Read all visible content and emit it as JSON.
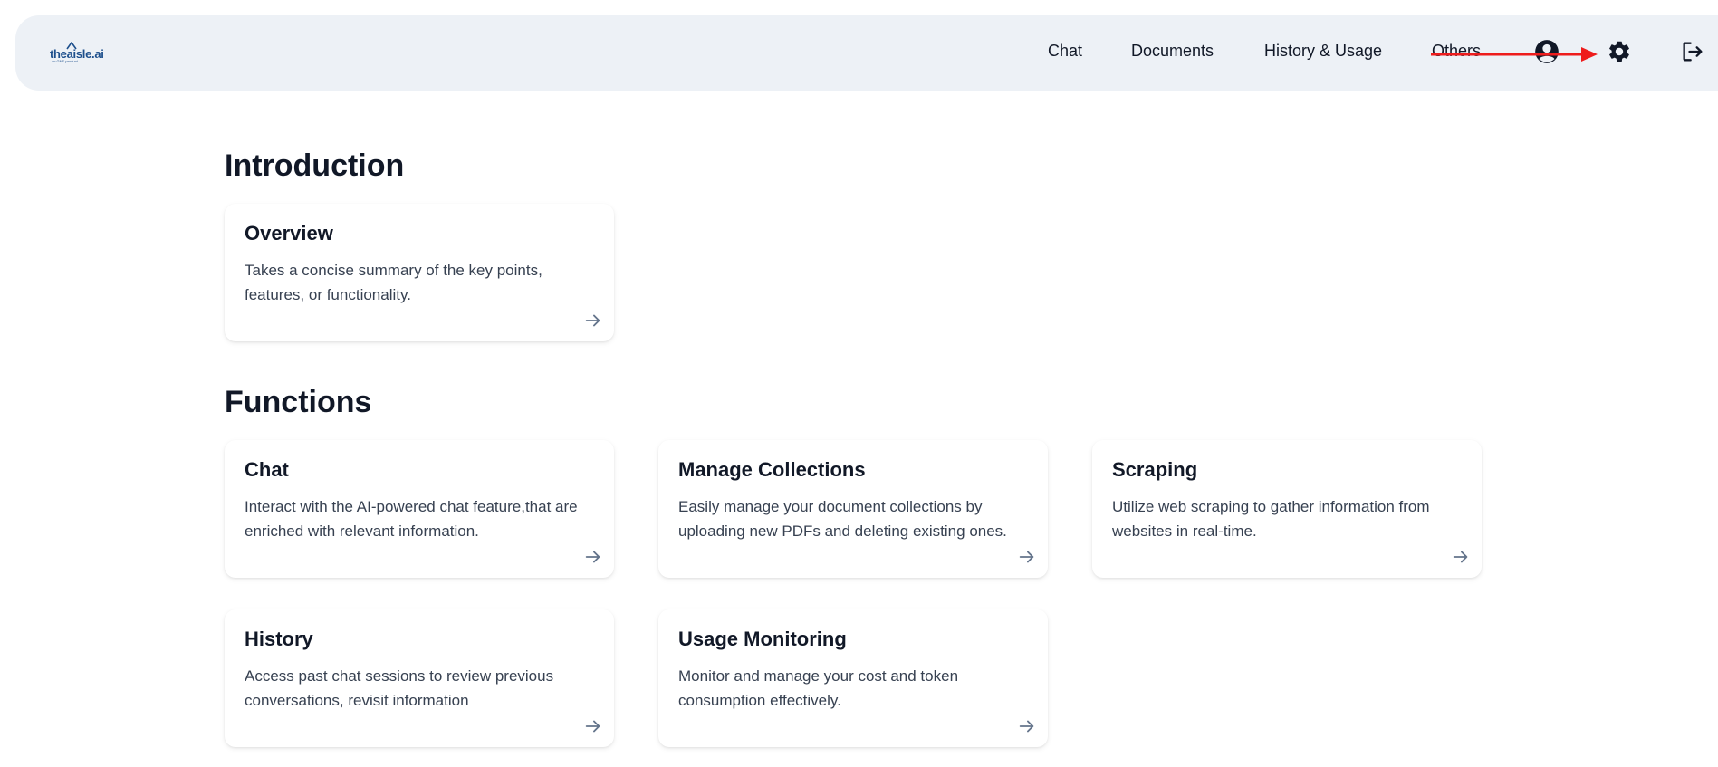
{
  "app": {
    "logo_text": "theaisle.ai",
    "logo_sub": "an GNE product"
  },
  "nav": {
    "links": [
      "Chat",
      "Documents",
      "History & Usage",
      "Others"
    ],
    "icons": [
      "user-circle-icon",
      "gear-icon",
      "logout-icon"
    ]
  },
  "sections": {
    "introduction": {
      "title": "Introduction",
      "cards": [
        {
          "title": "Overview",
          "description": "Takes a concise summary of the key points, features, or functionality."
        }
      ]
    },
    "functions": {
      "title": "Functions",
      "cards": [
        {
          "title": "Chat",
          "description": "Interact with the AI-powered chat feature,that are enriched with relevant information."
        },
        {
          "title": "Manage Collections",
          "description": "Easily manage your document collections by uploading new PDFs and deleting existing ones."
        },
        {
          "title": "Scraping",
          "description": "Utilize web scraping to gather information from websites in real-time."
        },
        {
          "title": "History",
          "description": "Access past chat sessions to review previous conversations, revisit information"
        },
        {
          "title": "Usage Monitoring",
          "description": "Monitor and manage your cost and token consumption effectively."
        }
      ]
    }
  },
  "colors": {
    "navbar_bg": "#edf1f6",
    "annotation_arrow": "#ee1c1c",
    "card_arrow": "#64748b",
    "text_dark": "#111827"
  }
}
